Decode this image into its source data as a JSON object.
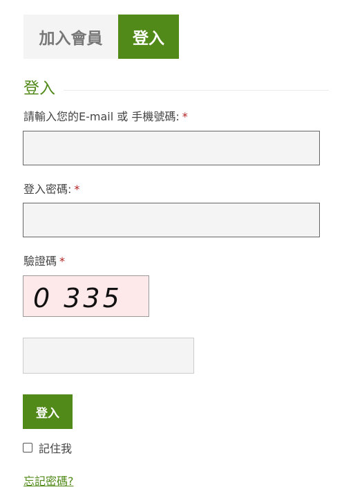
{
  "tabs": {
    "join_label": "加入會員",
    "login_label": "登入"
  },
  "section": {
    "title": "登入"
  },
  "form": {
    "account_label": "請輸入您的E-mail 或 手機號碼:",
    "password_label": "登入密碼:",
    "captcha_label": "驗證碼",
    "required_mark": "*",
    "captcha_code": "0 335",
    "account_value": "",
    "password_value": "",
    "captcha_value": "",
    "submit_label": "登入",
    "remember_label": "記住我",
    "forgot_label": "忘記密碼?"
  },
  "colors": {
    "accent": "#528a1a",
    "tab_inactive_bg": "#f4f4f4",
    "captcha_bg": "#fde8ea",
    "required": "#b22222"
  },
  "icons": {
    "remember": "checkbox-icon"
  }
}
